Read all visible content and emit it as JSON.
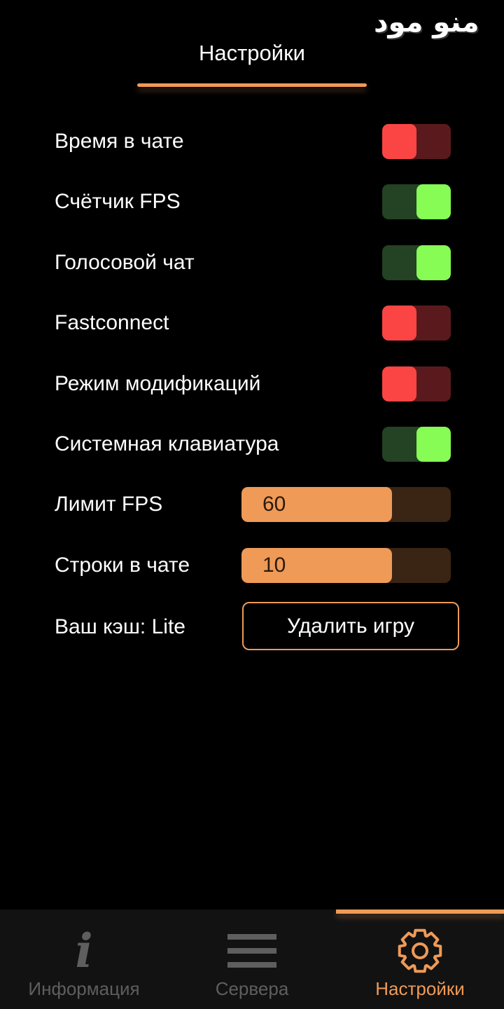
{
  "watermark": "منو مود",
  "header": {
    "title": "Настройки"
  },
  "settings": {
    "chat_time": {
      "label": "Время в чате",
      "state": "off"
    },
    "fps_counter": {
      "label": "Счётчик FPS",
      "state": "on"
    },
    "voice_chat": {
      "label": "Голосовой чат",
      "state": "on"
    },
    "fastconnect": {
      "label": "Fastconnect",
      "state": "off"
    },
    "mod_mode": {
      "label": "Режим модификаций",
      "state": "off"
    },
    "system_keyboard": {
      "label": "Системная клавиатура",
      "state": "on"
    },
    "fps_limit": {
      "label": "Лимит FPS",
      "value": "60",
      "fill_fraction": 0.72
    },
    "chat_lines": {
      "label": "Строки в чате",
      "value": "10",
      "fill_fraction": 0.72
    },
    "cache": {
      "label": "Ваш кэш: Lite",
      "button": "Удалить игру"
    }
  },
  "colors": {
    "accent": "#ef9a57",
    "toggle_on": "#86fc55",
    "toggle_off": "#fb4544",
    "nav_inactive": "#5e5e5e"
  },
  "nav": {
    "items": [
      {
        "label": "Информация",
        "icon": "info-icon",
        "active": false
      },
      {
        "label": "Сервера",
        "icon": "menu-icon",
        "active": false
      },
      {
        "label": "Настройки",
        "icon": "gear-icon",
        "active": true
      }
    ]
  }
}
